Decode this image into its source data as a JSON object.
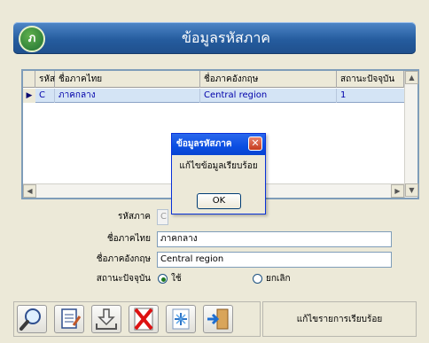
{
  "header": {
    "title": "ข้อมูลรหัสภาค",
    "logo_text": "ภ"
  },
  "grid": {
    "columns": [
      "รหัส",
      "ชื่อภาคไทย",
      "ชื่อภาคอังกฤษ",
      "สถานะปัจจุบัน"
    ],
    "rows": [
      {
        "code": "C",
        "name_th": "ภาคกลาง",
        "name_en": "Central region",
        "status": "1"
      }
    ]
  },
  "form": {
    "code": {
      "label": "รหัสภาค",
      "value": "C"
    },
    "name_th": {
      "label": "ชื่อภาคไทย",
      "value": "ภาคกลาง"
    },
    "name_en": {
      "label": "ชื่อภาคอังกฤษ",
      "value": "Central region"
    },
    "status": {
      "label": "สถานะปัจจุบัน",
      "options": [
        "ใช้",
        "ยกเลิก"
      ],
      "selected": "ใช้"
    }
  },
  "toolbar": {
    "buttons": [
      "search-icon",
      "edit-document-icon",
      "download-icon",
      "delete-icon",
      "sparkle-icon",
      "exit-icon"
    ]
  },
  "status_message": "แก้ไขรายการเรียบร้อย",
  "dialog": {
    "title": "ข้อมูลรหัสภาค",
    "message": "แก้ไขข้อมูลเรียบร้อย",
    "ok_label": "OK"
  },
  "colors": {
    "header": "#255c9e",
    "selected_row": "#d4e4f5",
    "dialog_title": "#0b4ee2"
  }
}
